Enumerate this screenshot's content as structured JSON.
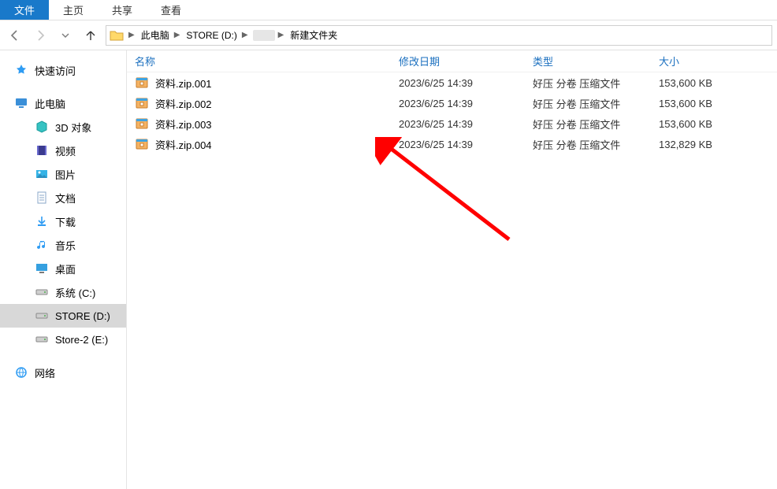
{
  "ribbon": {
    "tabs": [
      "文件",
      "主页",
      "共享",
      "查看"
    ]
  },
  "breadcrumb": {
    "items": [
      "此电脑",
      "STORE (D:)",
      "",
      "新建文件夹"
    ]
  },
  "columns": {
    "name": "名称",
    "date": "修改日期",
    "type": "类型",
    "size": "大小"
  },
  "sidebar": {
    "quick": "快速访问",
    "pc": "此电脑",
    "pc_children": [
      {
        "label": "3D 对象",
        "icon": "cube"
      },
      {
        "label": "视频",
        "icon": "film"
      },
      {
        "label": "图片",
        "icon": "picture"
      },
      {
        "label": "文档",
        "icon": "doc"
      },
      {
        "label": "下载",
        "icon": "download"
      },
      {
        "label": "音乐",
        "icon": "music"
      },
      {
        "label": "桌面",
        "icon": "desktop"
      },
      {
        "label": "系统 (C:)",
        "icon": "drive"
      },
      {
        "label": "STORE (D:)",
        "icon": "drive",
        "selected": true
      },
      {
        "label": "Store-2 (E:)",
        "icon": "drive"
      }
    ],
    "network": "网络"
  },
  "files": [
    {
      "name": "资料.zip.001",
      "date": "2023/6/25 14:39",
      "type": "好压 分卷 压缩文件",
      "size": "153,600 KB"
    },
    {
      "name": "资料.zip.002",
      "date": "2023/6/25 14:39",
      "type": "好压 分卷 压缩文件",
      "size": "153,600 KB"
    },
    {
      "name": "资料.zip.003",
      "date": "2023/6/25 14:39",
      "type": "好压 分卷 压缩文件",
      "size": "153,600 KB"
    },
    {
      "name": "资料.zip.004",
      "date": "2023/6/25 14:39",
      "type": "好压 分卷 压缩文件",
      "size": "132,829 KB"
    }
  ]
}
